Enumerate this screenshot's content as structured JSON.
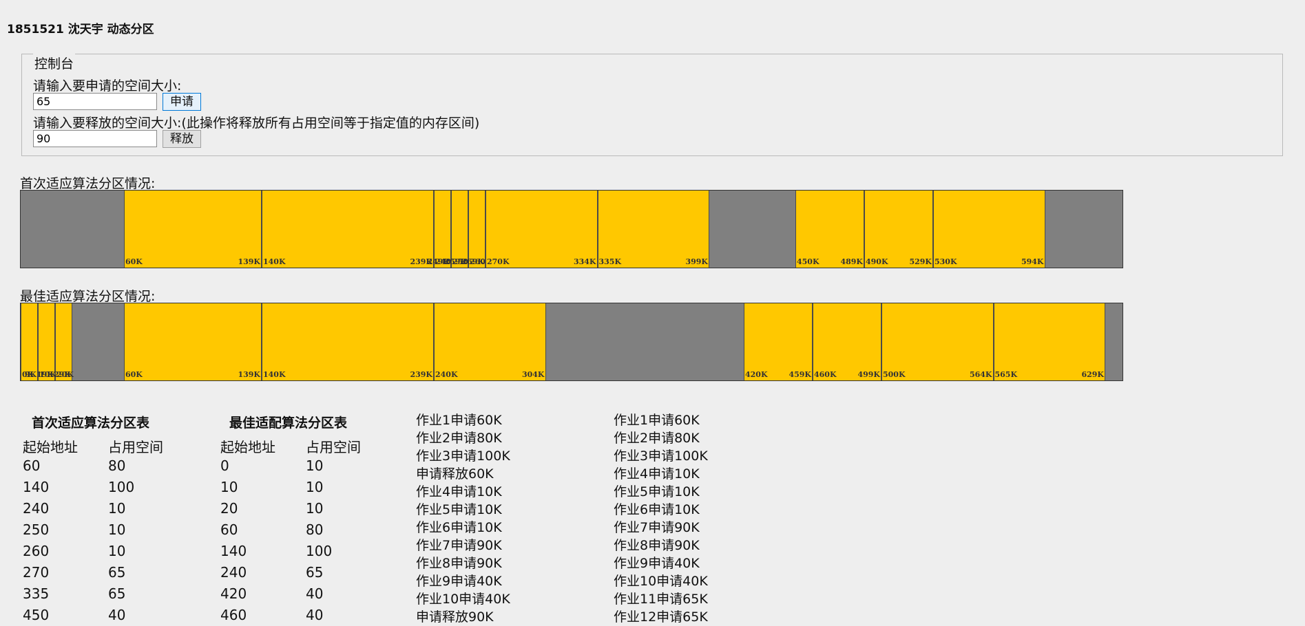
{
  "header": {
    "title": "1851521 沈天宇 动态分区"
  },
  "console": {
    "legend": "控制台",
    "apply_label": "请输入要申请的空间大小:",
    "apply_value": "65",
    "apply_button": "申请",
    "release_label": "请输入要释放的空间大小:(此操作将释放所有占用空间等于指定值的内存区间)",
    "release_value": "90",
    "release_button": "释放"
  },
  "colors": {
    "occupied": "#ffc800",
    "free": "#808080",
    "background": "#eeeeee"
  },
  "memory_total_k": 640,
  "first_fit": {
    "label": "首次适应算法分区情况:",
    "segments": [
      {
        "start": 60,
        "size": 80,
        "start_label": "60K",
        "end_label": "139K"
      },
      {
        "start": 140,
        "size": 100,
        "start_label": "140K",
        "end_label": "239K"
      },
      {
        "start": 240,
        "size": 10,
        "start_label": "240K",
        "end_label": "249K"
      },
      {
        "start": 250,
        "size": 10,
        "start_label": "250K",
        "end_label": "259K"
      },
      {
        "start": 260,
        "size": 10,
        "start_label": "260K",
        "end_label": "269K"
      },
      {
        "start": 270,
        "size": 65,
        "start_label": "270K",
        "end_label": "334K"
      },
      {
        "start": 335,
        "size": 65,
        "start_label": "335K",
        "end_label": "399K"
      },
      {
        "start": 450,
        "size": 40,
        "start_label": "450K",
        "end_label": "489K"
      },
      {
        "start": 490,
        "size": 40,
        "start_label": "490K",
        "end_label": "529K"
      },
      {
        "start": 530,
        "size": 65,
        "start_label": "530K",
        "end_label": "594K"
      }
    ]
  },
  "best_fit": {
    "label": "最佳适应算法分区情况:",
    "segments": [
      {
        "start": 0,
        "size": 10,
        "start_label": "0K",
        "end_label": "9K"
      },
      {
        "start": 10,
        "size": 10,
        "start_label": "10K",
        "end_label": "19K"
      },
      {
        "start": 20,
        "size": 10,
        "start_label": "20K",
        "end_label": "29K"
      },
      {
        "start": 60,
        "size": 80,
        "start_label": "60K",
        "end_label": "139K"
      },
      {
        "start": 140,
        "size": 100,
        "start_label": "140K",
        "end_label": "239K"
      },
      {
        "start": 240,
        "size": 65,
        "start_label": "240K",
        "end_label": "304K"
      },
      {
        "start": 420,
        "size": 40,
        "start_label": "420K",
        "end_label": "459K"
      },
      {
        "start": 460,
        "size": 40,
        "start_label": "460K",
        "end_label": "499K"
      },
      {
        "start": 500,
        "size": 65,
        "start_label": "500K",
        "end_label": "564K"
      },
      {
        "start": 565,
        "size": 65,
        "start_label": "565K",
        "end_label": "629K"
      }
    ]
  },
  "first_fit_table": {
    "title": "首次适应算法分区表",
    "headers": [
      "起始地址",
      "占用空间"
    ],
    "rows": [
      [
        "60",
        "80"
      ],
      [
        "140",
        "100"
      ],
      [
        "240",
        "10"
      ],
      [
        "250",
        "10"
      ],
      [
        "260",
        "10"
      ],
      [
        "270",
        "65"
      ],
      [
        "335",
        "65"
      ],
      [
        "450",
        "40"
      ]
    ]
  },
  "best_fit_table": {
    "title": "最佳适配算法分区表",
    "headers": [
      "起始地址",
      "占用空间"
    ],
    "rows": [
      [
        "0",
        "10"
      ],
      [
        "10",
        "10"
      ],
      [
        "20",
        "10"
      ],
      [
        "60",
        "80"
      ],
      [
        "140",
        "100"
      ],
      [
        "240",
        "65"
      ],
      [
        "420",
        "40"
      ],
      [
        "460",
        "40"
      ]
    ]
  },
  "first_fit_log": [
    "作业1申请60K",
    "作业2申请80K",
    "作业3申请100K",
    "申请释放60K",
    "作业4申请10K",
    "作业5申请10K",
    "作业6申请10K",
    "作业7申请90K",
    "作业8申请90K",
    "作业9申请40K",
    "作业10申请40K",
    "申请释放90K"
  ],
  "best_fit_log": [
    "作业1申请60K",
    "作业2申请80K",
    "作业3申请100K",
    "作业4申请10K",
    "作业5申请10K",
    "作业6申请10K",
    "作业7申请90K",
    "作业8申请90K",
    "作业9申请40K",
    "作业10申请40K",
    "作业11申请65K",
    "作业12申请65K"
  ]
}
